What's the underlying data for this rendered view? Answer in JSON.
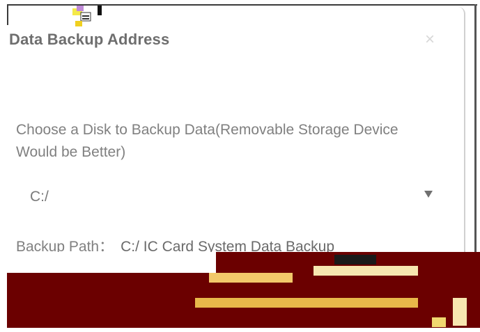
{
  "dialog": {
    "title": "Data Backup Address",
    "close_glyph": "×",
    "instruction": "Choose a Disk to Backup Data(Removable Storage Device Would be Better)",
    "disk_select": {
      "selected_value": "C:/",
      "icon": "caret-down-icon"
    },
    "backup_path": {
      "label": "Backup Path：",
      "value": "C:/ IC Card System Data Backup"
    }
  },
  "colors": {
    "title_text": "#6e6e6e",
    "body_text": "#808080",
    "band": "#6b0000",
    "band_accent": "#e8b84a"
  }
}
